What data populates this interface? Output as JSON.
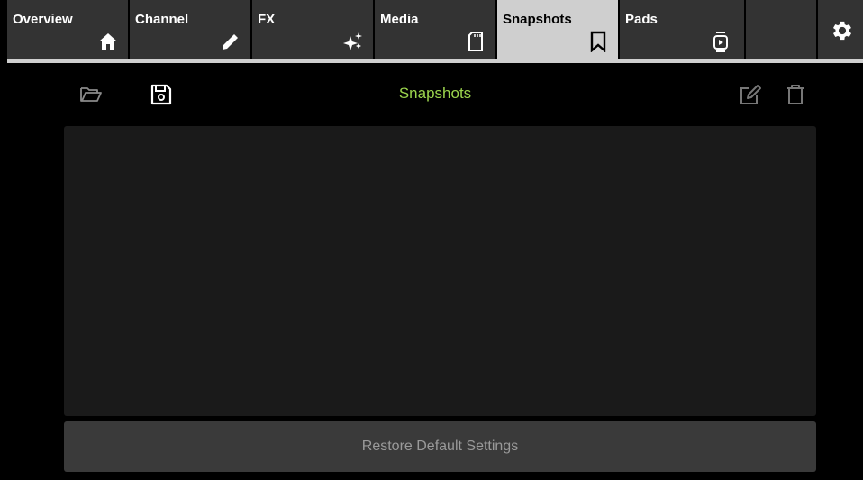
{
  "tabs": [
    {
      "label": "Overview",
      "icon": "home-icon"
    },
    {
      "label": "Channel",
      "icon": "pencil-icon"
    },
    {
      "label": "FX",
      "icon": "sparkle-icon"
    },
    {
      "label": "Media",
      "icon": "sd-card-icon"
    },
    {
      "label": "Snapshots",
      "icon": "bookmark-icon",
      "active": true
    },
    {
      "label": "Pads",
      "icon": "pad-play-icon"
    }
  ],
  "settings_icon": "gear-icon",
  "header": {
    "title": "Snapshots",
    "left_icons": [
      "folder-open-icon",
      "save-icon"
    ],
    "right_icons": [
      "edit-icon",
      "trash-icon"
    ]
  },
  "restore_button": {
    "label": "Restore Default Settings"
  },
  "colors": {
    "accent_green": "#9bd44d",
    "active_tab": "#cfcfcf",
    "tab_bg": "#333333",
    "panel_bg": "#1a1a1a"
  }
}
